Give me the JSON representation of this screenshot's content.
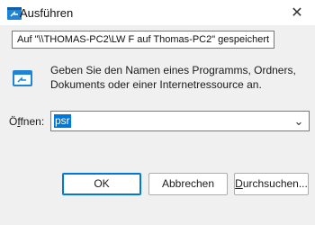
{
  "window": {
    "title": "Ausführen",
    "close_glyph": "✕"
  },
  "tooltip": {
    "text": "Auf \"\\\\THOMAS-PC2\\LW F auf Thomas-PC2\" gespeichert"
  },
  "dialog": {
    "description_line1": "Geben Sie den Namen eines Programms, Ordners,",
    "description_line2": "Dokuments oder einer Internetressource an.",
    "open_label_accel": "f",
    "open_label_prefix": "Ö",
    "open_label_suffix": "fnen:",
    "open_value": "psr",
    "dropdown_glyph": "⌄"
  },
  "buttons": {
    "ok": "OK",
    "cancel": "Abbrechen",
    "browse_accel": "D",
    "browse_rest": "urchsuchen..."
  },
  "icons": {
    "app": "run-icon",
    "close": "close-icon",
    "dropdown": "chevron-down-icon"
  },
  "colors": {
    "accent": "#0078d7",
    "background": "#f0f0f0"
  }
}
